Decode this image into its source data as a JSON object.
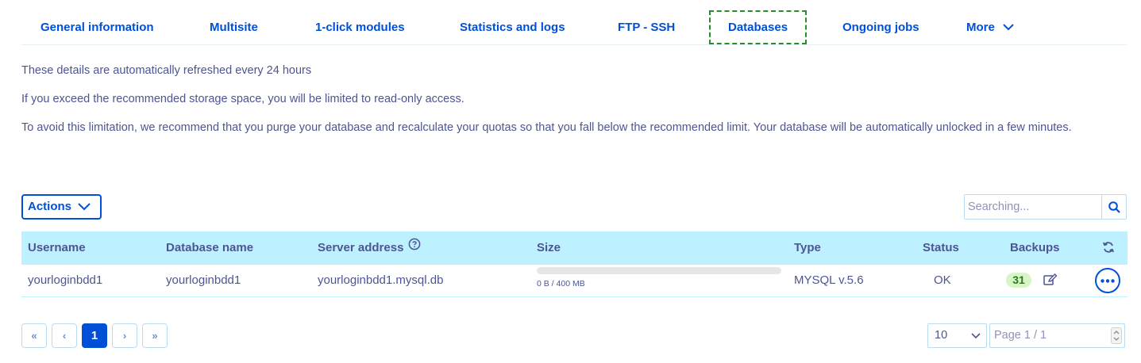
{
  "tabs": [
    {
      "label": "General information"
    },
    {
      "label": "Multisite"
    },
    {
      "label": "1-click modules"
    },
    {
      "label": "Statistics and logs"
    },
    {
      "label": "FTP - SSH"
    },
    {
      "label": "Databases",
      "active": true
    },
    {
      "label": "Ongoing jobs"
    },
    {
      "label": "More"
    }
  ],
  "info": {
    "line1": "These details are automatically refreshed every 24 hours",
    "line2": "If you exceed the recommended storage space, you will be limited to read-only access.",
    "line3": "To avoid this limitation, we recommend that you purge your database and recalculate your quotas so that you fall below the recommended limit. Your database will be automatically unlocked in a few minutes."
  },
  "toolbar": {
    "actions_label": "Actions",
    "search_placeholder": "Searching..."
  },
  "table": {
    "columns": {
      "username": "Username",
      "database_name": "Database name",
      "server_address": "Server address",
      "size": "Size",
      "type": "Type",
      "status": "Status",
      "backups": "Backups"
    },
    "rows": [
      {
        "username": "yourloginbdd1",
        "database_name": "yourloginbdd1",
        "server_address": "yourloginbdd1.mysql.db",
        "size_label": "0 B / 400 MB",
        "size_used_fraction": 0,
        "type": "MYSQL v.5.6",
        "status": "OK",
        "backups_count": "31"
      }
    ]
  },
  "pagination": {
    "first": "«",
    "prev": "‹",
    "current": "1",
    "next": "›",
    "last": "»",
    "per_page": "10",
    "page_placeholder": "Page 1 / 1"
  },
  "colors": {
    "accent": "#0050d7",
    "header_bg": "#bef1ff",
    "text": "#4d5592",
    "badge_bg": "#d7f5c6"
  },
  "icons": {
    "more_chevron": "chevron-down-icon",
    "actions_chevron": "chevron-down-icon",
    "search": "search-icon",
    "help": "question-circle-icon",
    "refresh": "refresh-icon",
    "edit": "edit-icon",
    "row_menu": "ellipsis-icon"
  }
}
